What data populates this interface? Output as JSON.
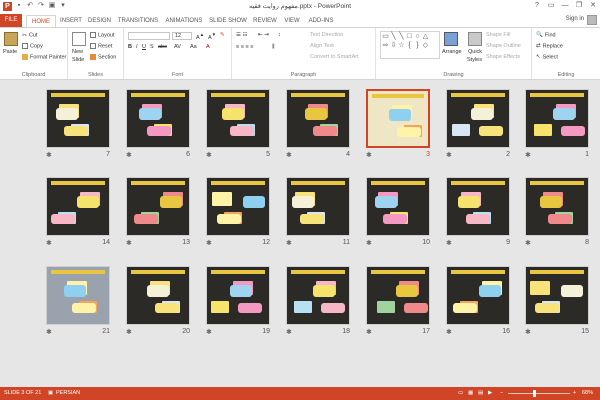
{
  "window": {
    "title": "مفهوم روایت فقیه.pptx - PowerPoint",
    "controls": [
      "?",
      "▭",
      "—",
      "❐",
      "✕"
    ],
    "app_icon": "P"
  },
  "qat": [
    "save-icon",
    "undo-icon",
    "redo-icon",
    "present-icon",
    "dropdown-icon"
  ],
  "tabs": [
    "FILE",
    "HOME",
    "INSERT",
    "DESIGN",
    "TRANSITIONS",
    "ANIMATIONS",
    "SLIDE SHOW",
    "REVIEW",
    "VIEW",
    "ADD-INS"
  ],
  "active_tab": "HOME",
  "signin": "Sign in",
  "ribbon": {
    "clipboard": {
      "label": "Clipboard",
      "paste": "Paste",
      "cut": "Cut",
      "copy": "Copy",
      "format_painter": "Format Painter"
    },
    "slides": {
      "label": "Slides",
      "new_slide": "New",
      "new_slide2": "Slide",
      "layout": "Layout",
      "reset": "Reset",
      "section": "Section"
    },
    "font": {
      "label": "Font",
      "size": "12",
      "bold": "B",
      "italic": "I",
      "underline": "U",
      "strike": "S",
      "abc": "abc",
      "aa": "Aa",
      "case": "A"
    },
    "paragraph": {
      "label": "Paragraph",
      "text_direction": "Text Direction",
      "align_text": "Align Text",
      "convert": "Convert to SmartArt"
    },
    "drawing": {
      "label": "Drawing",
      "arrange": "Arrange",
      "quick_styles": "Quick",
      "quick_styles2": "Styles",
      "shape_fill": "Shape Fill",
      "shape_outline": "Shape Outline",
      "shape_effects": "Shape Effects"
    },
    "editing": {
      "label": "Editing",
      "find": "Find",
      "replace": "Replace",
      "select": "Select"
    }
  },
  "slides": [
    {
      "num": "7",
      "star": "✱"
    },
    {
      "num": "6",
      "star": "✱"
    },
    {
      "num": "5",
      "star": "✱"
    },
    {
      "num": "4",
      "star": "✱"
    },
    {
      "num": "3",
      "star": "✱",
      "selected": true
    },
    {
      "num": "2",
      "star": "✱"
    },
    {
      "num": "1",
      "star": "✱"
    },
    {
      "num": "14",
      "star": "✱"
    },
    {
      "num": "13",
      "star": "✱"
    },
    {
      "num": "12",
      "star": "✱"
    },
    {
      "num": "11",
      "star": "✱"
    },
    {
      "num": "10",
      "star": "✱"
    },
    {
      "num": "9",
      "star": "✱"
    },
    {
      "num": "8",
      "star": "✱"
    },
    {
      "num": "21",
      "star": "✱"
    },
    {
      "num": "20",
      "star": "✱"
    },
    {
      "num": "19",
      "star": "✱"
    },
    {
      "num": "18",
      "star": "✱"
    },
    {
      "num": "17",
      "star": "✱"
    },
    {
      "num": "16",
      "star": "✱"
    },
    {
      "num": "15",
      "star": "✱"
    }
  ],
  "status": {
    "slide_info": "SLIDE 3 OF 21",
    "language": "PERSIAN",
    "zoom": "68%",
    "minus": "−",
    "plus": "+"
  },
  "colors": {
    "accent": "#d04526",
    "slide_bg": "#2c2a27",
    "slide_title": "#e9c640"
  }
}
